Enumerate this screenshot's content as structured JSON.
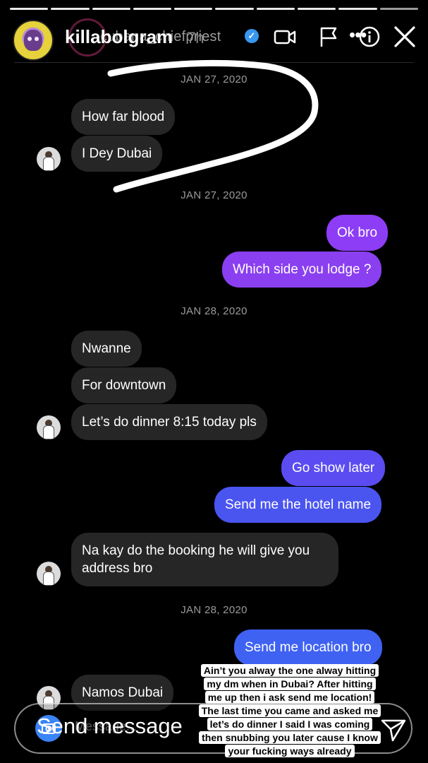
{
  "story": {
    "progress": {
      "total_segments": 10,
      "completed_segments": 9
    },
    "username": "killabolgram",
    "underlying_name": "cubana_chiefpriest",
    "time_ago": "7h",
    "icons": [
      "video-camera-icon",
      "flag-icon",
      "info-icon",
      "close-icon",
      "more-icon"
    ]
  },
  "chat": {
    "messages": [
      {
        "type": "date",
        "text": "JAN 27, 2020"
      },
      {
        "type": "in",
        "text": "How far blood"
      },
      {
        "type": "in",
        "text": "I Dey Dubai",
        "avatar": true
      },
      {
        "type": "date",
        "text": "JAN 27, 2020"
      },
      {
        "type": "out",
        "text": "Ok bro",
        "color": "#8d3df5"
      },
      {
        "type": "out",
        "text": "Which side you lodge ?",
        "color": "#8a3ff0"
      },
      {
        "type": "date",
        "text": "JAN 28, 2020"
      },
      {
        "type": "in",
        "text": "Nwanne"
      },
      {
        "type": "in",
        "text": "For downtown"
      },
      {
        "type": "in",
        "text": "Let’s do dinner 8:15 today pls",
        "avatar": true
      },
      {
        "type": "out",
        "text": "Go show later",
        "color": "#5a4cf0"
      },
      {
        "type": "out",
        "text": "Send me the hotel name",
        "color": "#4a55f0"
      },
      {
        "type": "in",
        "text": "Na kay do the booking he will give you address bro",
        "avatar": true
      },
      {
        "type": "date",
        "text": "JAN 28, 2020"
      },
      {
        "type": "out",
        "text": "Send me location bro",
        "color": "#3f62f2"
      },
      {
        "type": "in",
        "text": "Namos Dubai",
        "avatar": true
      }
    ]
  },
  "caption": {
    "lines": [
      "Ain’t you alway the one alway hitting",
      "my dm when in Dubai?  After hitting",
      "me up then i ask send me location!",
      "The last time you came and asked me",
      "let’s do dinner I said I was coming",
      "then snubbing you later cause I know",
      "your fucking ways already"
    ]
  },
  "reply": {
    "placeholder": "Send message",
    "ghost_placeholder": "Message..."
  },
  "colors": {
    "background": "#000000",
    "incoming_bubble": "#262626",
    "outgoing_purple": "#8d3df5",
    "outgoing_blue": "#3f62f2",
    "verified": "#3897f0"
  }
}
